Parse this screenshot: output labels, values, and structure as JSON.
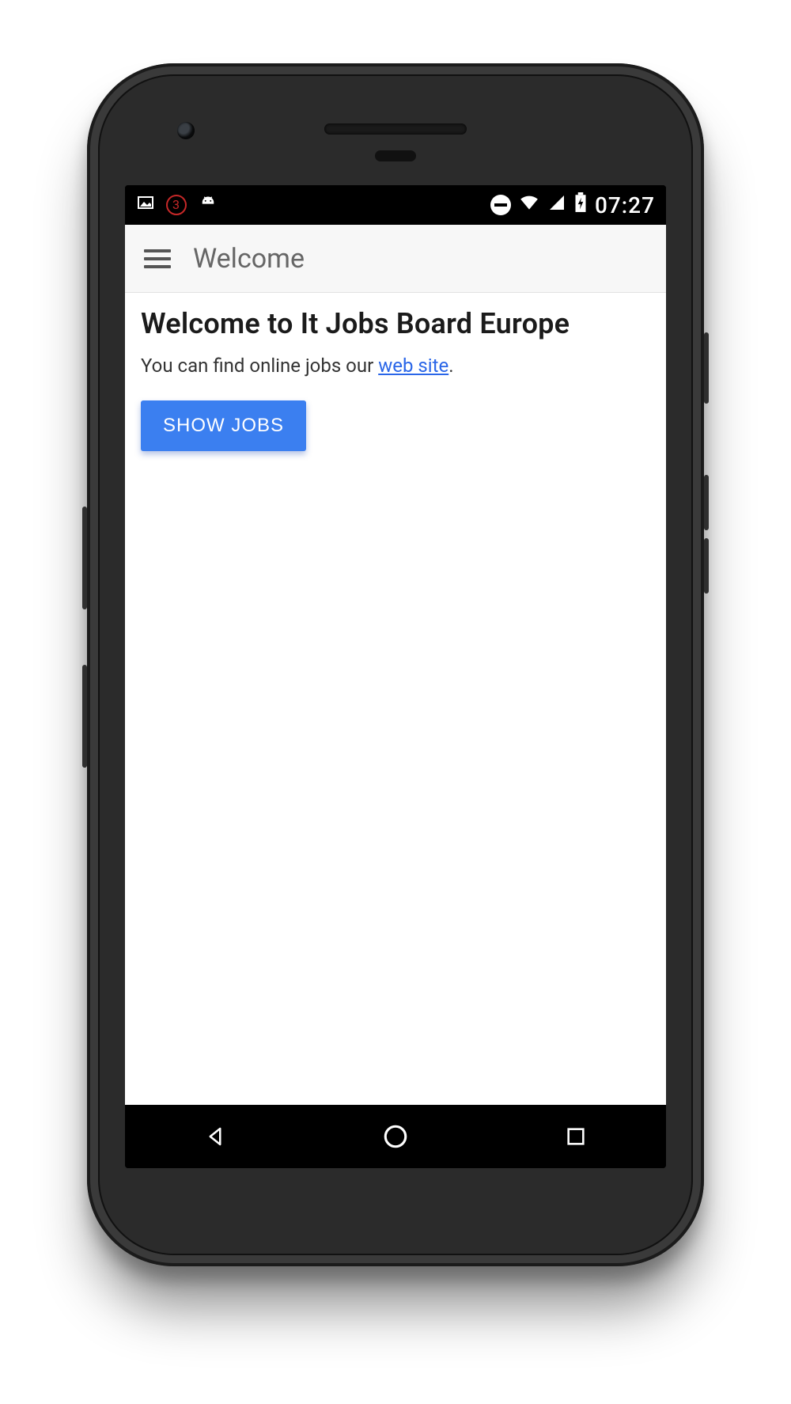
{
  "statusbar": {
    "notif_count": "3",
    "time": "07:27"
  },
  "appbar": {
    "title": "Welcome"
  },
  "main": {
    "heading": "Welcome to It Jobs Board Europe",
    "subtitle_prefix": "You can find online jobs our ",
    "subtitle_link": "web site",
    "subtitle_suffix": ".",
    "show_jobs_label": "SHOW JOBS"
  },
  "colors": {
    "accent": "#3b7ff0",
    "link": "#2a66e8"
  }
}
